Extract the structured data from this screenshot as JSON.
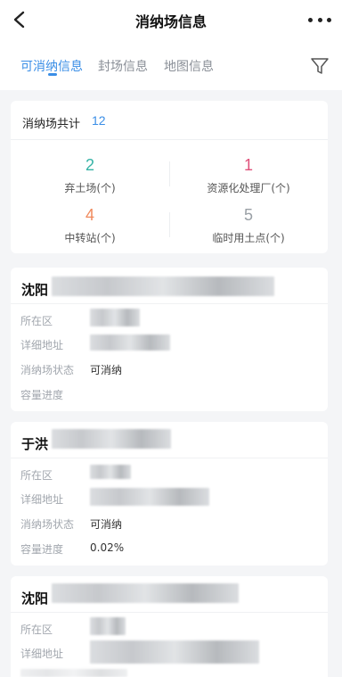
{
  "header": {
    "title": "消纳场信息"
  },
  "tabs": [
    {
      "label": "可消纳信息"
    },
    {
      "label": "封场信息"
    },
    {
      "label": "地图信息"
    }
  ],
  "summary": {
    "label": "消纳场共计",
    "total": "12",
    "stats": [
      {
        "value": "2",
        "label": "弃土场(个)",
        "color": "#36b3a6"
      },
      {
        "value": "1",
        "label": "资源化处理厂(个)",
        "color": "#e0507a"
      },
      {
        "value": "4",
        "label": "中转站(个)",
        "color": "#f08a5d"
      },
      {
        "value": "5",
        "label": "临时用土点(个)",
        "color": "#9aa0a6"
      }
    ]
  },
  "sites": [
    {
      "name": "沈阳",
      "fields": [
        {
          "label": "所在区",
          "value": ""
        },
        {
          "label": "详细地址",
          "value": ""
        },
        {
          "label": "消纳场状态",
          "value": "可消纳"
        },
        {
          "label": "容量进度",
          "value": ""
        }
      ]
    },
    {
      "name": "于洪",
      "fields": [
        {
          "label": "所在区",
          "value": ""
        },
        {
          "label": "详细地址",
          "value": ""
        },
        {
          "label": "消纳场状态",
          "value": "可消纳"
        },
        {
          "label": "容量进度",
          "value": "0.02%"
        }
      ]
    },
    {
      "name": "沈阳",
      "fields": [
        {
          "label": "所在区",
          "value": ""
        },
        {
          "label": "详细地址",
          "value": ""
        }
      ]
    }
  ],
  "colors": {
    "accent": "#3a8ee6"
  }
}
